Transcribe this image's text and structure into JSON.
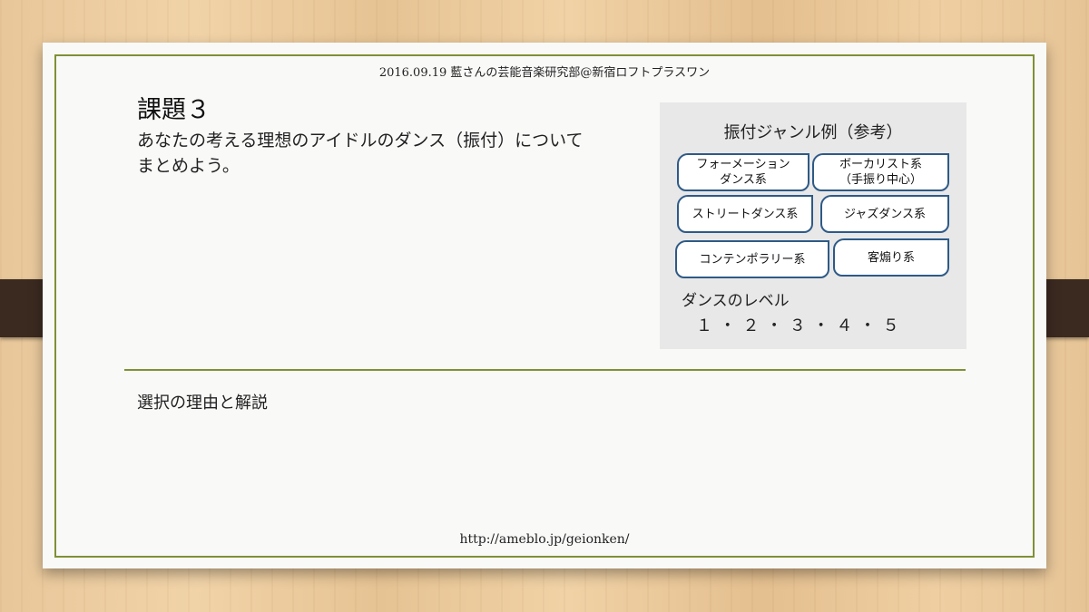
{
  "slide": {
    "header": "2016.09.19 藍さんの芸能音楽研究部@新宿ロフトプラスワン",
    "title": "課題３",
    "description_lines": [
      "あなたの考える理想のアイドルのダンス（振付）について",
      "まとめよう。"
    ],
    "panel": {
      "title": "振付ジャンル例（参考）",
      "genres": [
        {
          "line1": "フォーメーション",
          "line2": "ダンス系"
        },
        {
          "line1": "ボーカリスト系",
          "line2": "（手振り中心）"
        },
        {
          "line1": "ストリートダンス系",
          "line2": ""
        },
        {
          "line1": "ジャズダンス系",
          "line2": ""
        },
        {
          "line1": "コンテンポラリー系",
          "line2": ""
        },
        {
          "line1": "客煽り系",
          "line2": ""
        }
      ],
      "level_label": "ダンスのレベル",
      "level_scale": "１ ・ ２ ・ ３ ・ ４ ・ ５"
    },
    "reason_label": "選択の理由と解説",
    "footer_url": "http://ameblo.jp/geionken/"
  },
  "colors": {
    "frame_border": "#7e9135",
    "genre_border": "#2e5a87",
    "panel_bg": "#e8e8e8"
  }
}
